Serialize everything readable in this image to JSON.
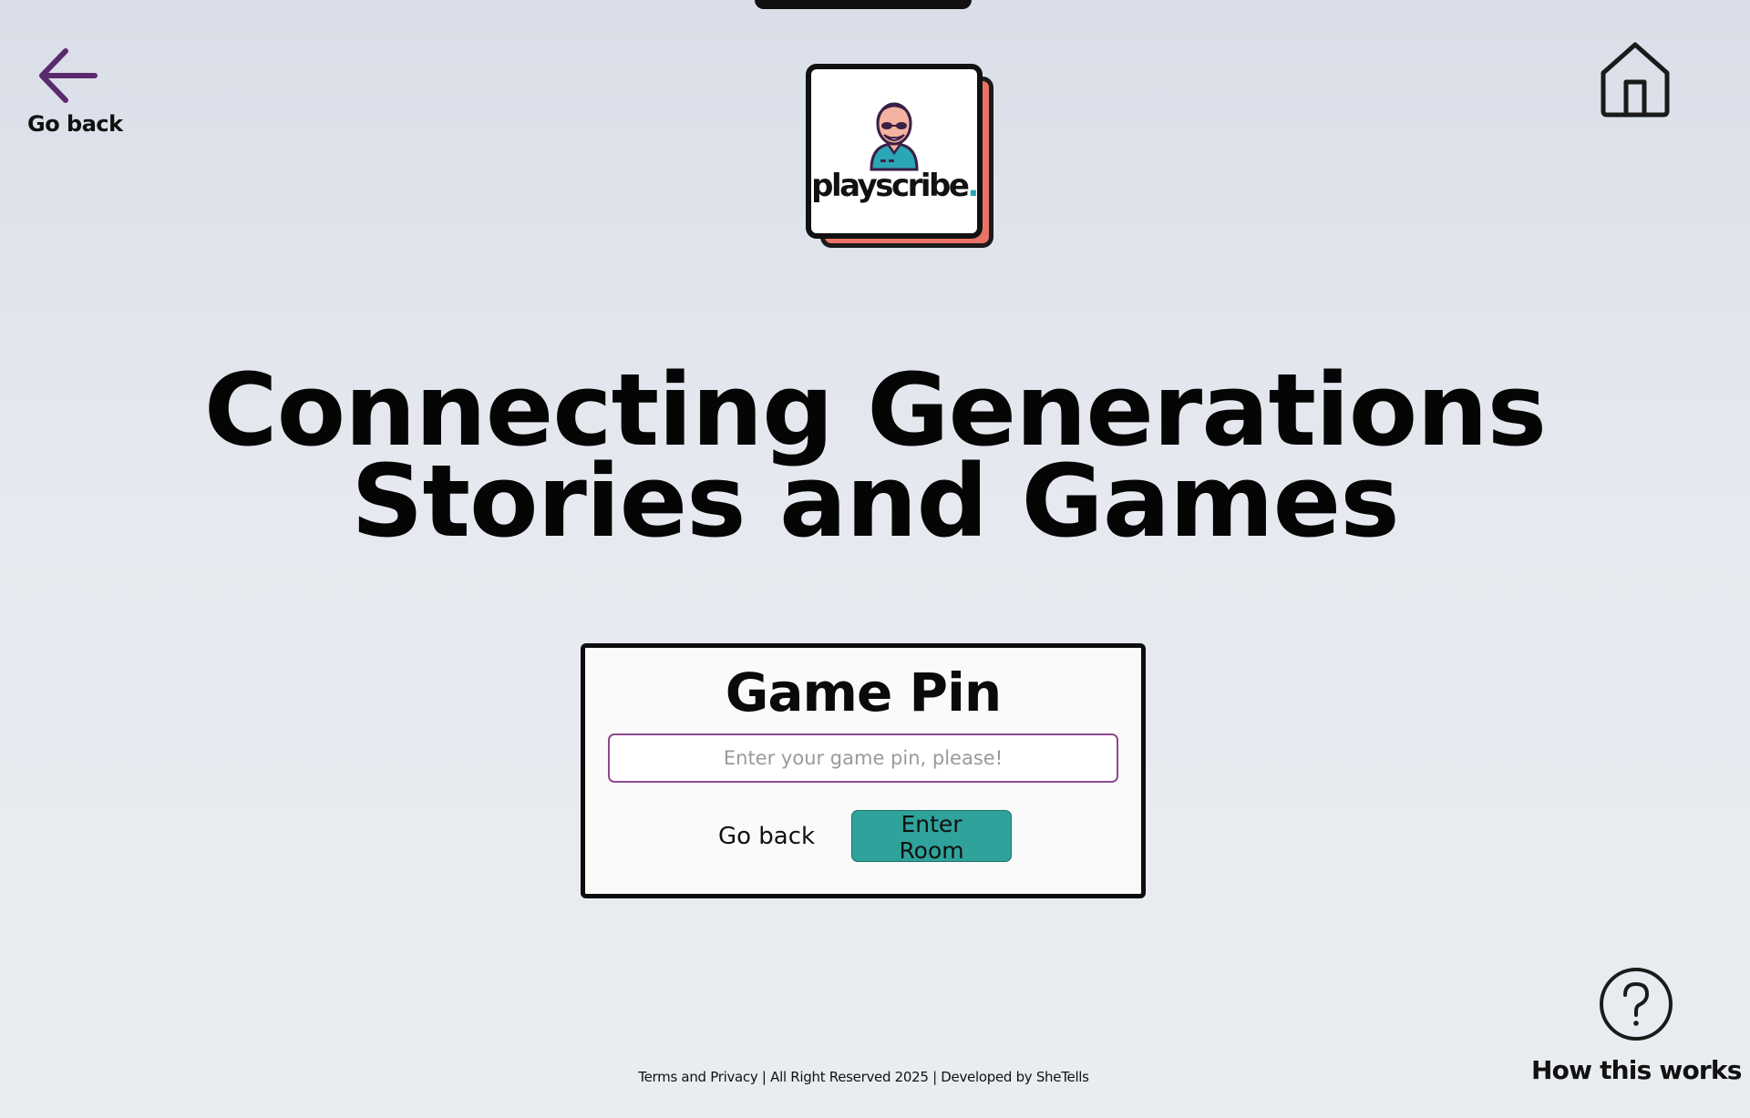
{
  "nav": {
    "back_label": "Go back",
    "back_icon": "arrow-left-icon",
    "home_icon": "home-icon"
  },
  "logo": {
    "brand_text": "playscribe",
    "brand_dot": ".",
    "icon": "elderly-person-icon"
  },
  "headline": {
    "line1": "Connecting Generations",
    "line2": "Stories and Games"
  },
  "pin_form": {
    "title": "Game Pin",
    "input_value": "",
    "input_placeholder": "Enter your game pin, please!",
    "back_label": "Go back",
    "submit_label": "Enter Room"
  },
  "help": {
    "label": "How this works",
    "icon": "question-circle-icon"
  },
  "footer": {
    "text": "Terms and Privacy | All Right Reserved 2025 | Developed by SheTells"
  },
  "colors": {
    "accent_purple": "#5b2a6e",
    "primary_button": "#2fa39b",
    "logo_shadow": "#e87365",
    "logo_dot": "#24a9b6"
  }
}
